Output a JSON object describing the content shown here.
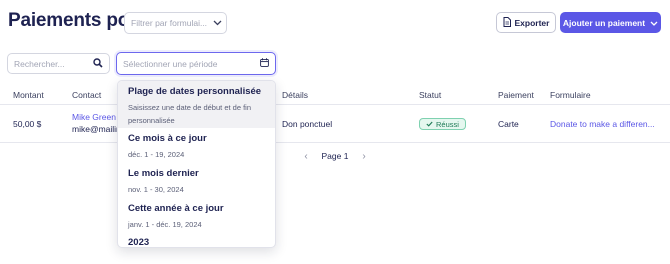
{
  "header": {
    "title": "Paiements pour",
    "form_filter_placeholder": "Filtrer par formulai...",
    "export_label": "Exporter",
    "add_payment_label": "Ajouter un paiement"
  },
  "filters": {
    "search_placeholder": "Rechercher...",
    "date_placeholder": "Sélectionner une période"
  },
  "table": {
    "columns": [
      "Montant",
      "Contact",
      "Détails",
      "Statut",
      "Paiement",
      "Formulaire"
    ],
    "rows": [
      {
        "amount": "50,00 $",
        "contact_name": "Mike Green",
        "contact_email": "mike@mailir",
        "details": "Don ponctuel",
        "status": "Réussi",
        "payment": "Carte",
        "form": "Donate to make a differen..."
      }
    ]
  },
  "pagination": {
    "label": "Page 1"
  },
  "date_dropdown": {
    "options": [
      {
        "title": "Plage de dates personnalisée",
        "subtitle": "Saisissez une date de début et de fin personnalisée"
      },
      {
        "title": "Ce mois à ce jour",
        "subtitle": "déc. 1 - 19, 2024"
      },
      {
        "title": "Le mois dernier",
        "subtitle": "nov. 1 - 30, 2024"
      },
      {
        "title": "Cette année à ce jour",
        "subtitle": "janv. 1 - déc. 19, 2024"
      },
      {
        "title": "2023",
        "subtitle": ""
      }
    ]
  },
  "colors": {
    "primary": "#5b57e6",
    "success_bg": "#e5f7ef",
    "success_text": "#1d7a55"
  }
}
